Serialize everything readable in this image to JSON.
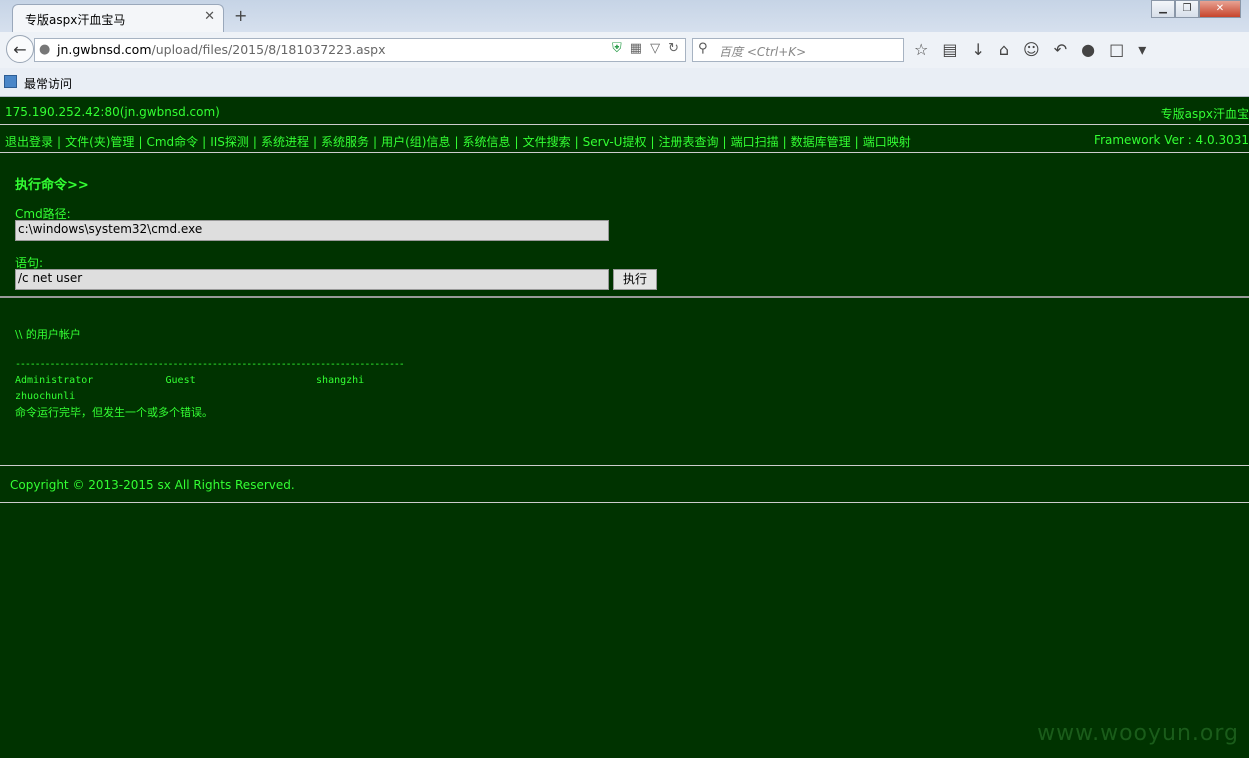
{
  "browser": {
    "tab_title": "专版aspx汗血宝马",
    "tab_close": "✕",
    "new_tab": "+",
    "url_host": "jn.gwbnsd.com",
    "url_path": "/upload/files/2015/8/181037223.aspx",
    "search_placeholder": "百度 <Ctrl+K>",
    "bookmark_label": "最常访问",
    "win_min": "▁",
    "win_max": "❐",
    "win_close": "✕"
  },
  "header": {
    "ip": "175.190.252.42:80(jn.gwbnsd.com)",
    "brand": "专版aspx汗血宝"
  },
  "menu": {
    "items": [
      "退出登录",
      "文件(夹)管理",
      "Cmd命令",
      "IIS探测",
      "系统进程",
      "系统服务",
      "用户(组)信息",
      "系统信息",
      "文件搜索",
      "Serv-U提权",
      "注册表查询",
      "端口扫描",
      "数据库管理",
      "端口映射"
    ],
    "framework": "Framework Ver : 4.0.3031"
  },
  "cmd": {
    "heading": "执行命令>>",
    "path_label": "Cmd路径:",
    "path_value": "c:\\windows\\system32\\cmd.exe",
    "stmt_label": "语句:",
    "stmt_value": "/c net user",
    "exec_button": "执行"
  },
  "output": {
    "line1": "\\\\ 的用户帐户",
    "divider": "-------------------------------------------------------------------------------",
    "users_row1": "Administrator            Guest                    shangzhi",
    "users_row2": "zhuochunli",
    "result": "命令运行完毕，但发生一个或多个错误。"
  },
  "footer": {
    "copyright": "Copyright © 2013-2015 sx All Rights Reserved."
  },
  "watermark": "www.wooyun.org"
}
